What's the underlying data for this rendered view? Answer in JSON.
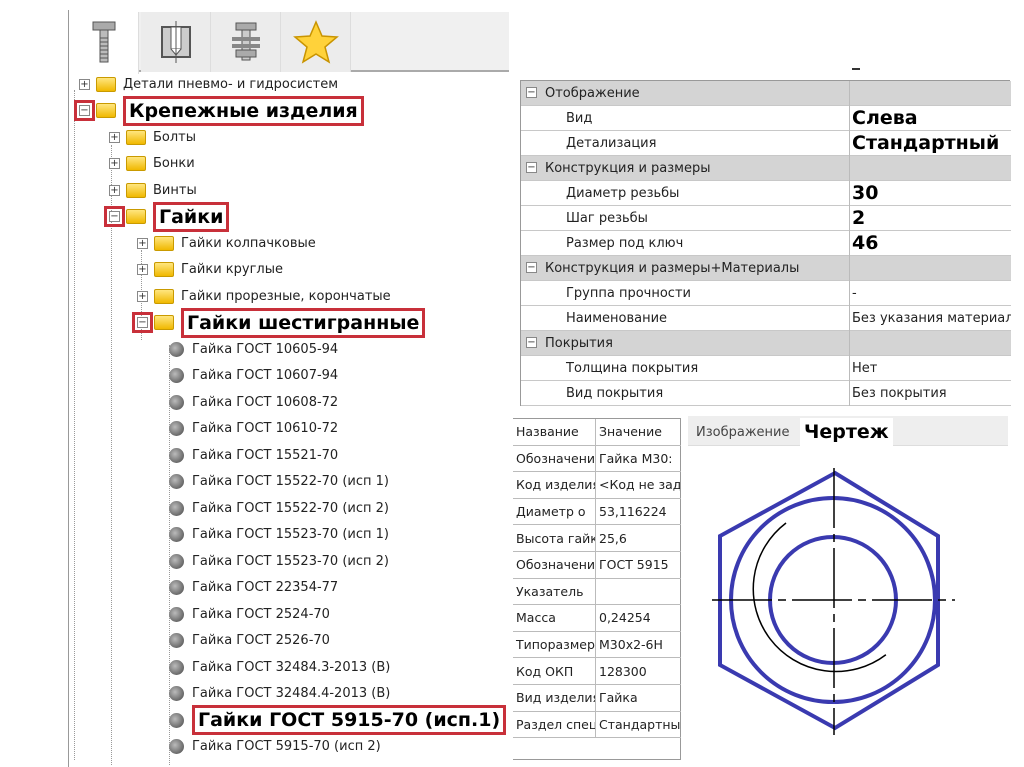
{
  "tabs": [
    {
      "icon": "bolt-icon"
    },
    {
      "icon": "hole-section-icon"
    },
    {
      "icon": "bolt-assembly-icon"
    },
    {
      "icon": "star-icon"
    }
  ],
  "tree": [
    {
      "label": "Детали пневмо- и гидросистем",
      "level": 0,
      "type": "folder",
      "exp": "+"
    },
    {
      "label": "Крепежные изделия",
      "level": 0,
      "type": "folder",
      "exp": "−",
      "hl": true
    },
    {
      "label": "Болты",
      "level": 1,
      "type": "folder",
      "exp": "+"
    },
    {
      "label": "Бонки",
      "level": 1,
      "type": "folder",
      "exp": "+"
    },
    {
      "label": "Винты",
      "level": 1,
      "type": "folder",
      "exp": "+"
    },
    {
      "label": "Гайки",
      "level": 1,
      "type": "folder",
      "exp": "−",
      "hl": true
    },
    {
      "label": "Гайки колпачковые",
      "level": 2,
      "type": "folder",
      "exp": "+"
    },
    {
      "label": "Гайки круглые",
      "level": 2,
      "type": "folder",
      "exp": "+"
    },
    {
      "label": "Гайки прорезные, корончатые",
      "level": 2,
      "type": "folder",
      "exp": "+"
    },
    {
      "label": "Гайки шестигранные",
      "level": 2,
      "type": "folder",
      "exp": "−",
      "hl": true
    },
    {
      "label": "Гайка ГОСТ 10605-94",
      "level": 3,
      "type": "item"
    },
    {
      "label": "Гайка ГОСТ 10607-94",
      "level": 3,
      "type": "item"
    },
    {
      "label": "Гайка ГОСТ 10608-72",
      "level": 3,
      "type": "item"
    },
    {
      "label": "Гайка ГОСТ 10610-72",
      "level": 3,
      "type": "item"
    },
    {
      "label": "Гайка ГОСТ 15521-70",
      "level": 3,
      "type": "item"
    },
    {
      "label": "Гайка ГОСТ 15522-70 (исп 1)",
      "level": 3,
      "type": "item"
    },
    {
      "label": "Гайка ГОСТ 15522-70 (исп 2)",
      "level": 3,
      "type": "item"
    },
    {
      "label": "Гайка ГОСТ 15523-70 (исп 1)",
      "level": 3,
      "type": "item"
    },
    {
      "label": "Гайка ГОСТ 15523-70 (исп 2)",
      "level": 3,
      "type": "item"
    },
    {
      "label": "Гайка ГОСТ 22354-77",
      "level": 3,
      "type": "item"
    },
    {
      "label": "Гайка ГОСТ 2524-70",
      "level": 3,
      "type": "item"
    },
    {
      "label": "Гайка ГОСТ 2526-70",
      "level": 3,
      "type": "item"
    },
    {
      "label": "Гайка ГОСТ 32484.3-2013 (В)",
      "level": 3,
      "type": "item"
    },
    {
      "label": "Гайка ГОСТ 32484.4-2013 (В)",
      "level": 3,
      "type": "item"
    },
    {
      "label": "Гайки ГОСТ 5915-70 (исп.1)",
      "level": 3,
      "type": "item",
      "hl": true
    },
    {
      "label": "Гайка ГОСТ 5915-70 (исп 2)",
      "level": 3,
      "type": "item"
    }
  ],
  "properties": [
    {
      "name": "Отображение",
      "header": true
    },
    {
      "name": "Вид",
      "value": "Слева",
      "bold": true
    },
    {
      "name": "Детализация",
      "value": "Стандартный",
      "bold": true
    },
    {
      "name": "Конструкция и размеры",
      "header": true
    },
    {
      "name": "Диаметр резьбы",
      "value": "30",
      "bold": true
    },
    {
      "name": "Шаг резьбы",
      "value": "2",
      "bold": true
    },
    {
      "name": "Размер под ключ",
      "value": "46",
      "bold": true
    },
    {
      "name": "Конструкция и размеры+Материалы",
      "header": true
    },
    {
      "name": "Группа прочности",
      "value": "-"
    },
    {
      "name": "Наименование",
      "value": "Без указания материала"
    },
    {
      "name": "Покрытия",
      "header": true
    },
    {
      "name": "Толщина покрытия",
      "value": "Нет"
    },
    {
      "name": "Вид покрытия",
      "value": "Без покрытия"
    }
  ],
  "attributes": {
    "headers": [
      "Название",
      "Значение"
    ],
    "rows": [
      [
        "Обозначение",
        "Гайка М30:"
      ],
      [
        "Код изделия",
        "<Код не задан>"
      ],
      [
        "Диаметр о",
        "53,116224"
      ],
      [
        "Высота гайки",
        "25,6"
      ],
      [
        "Обозначение",
        "ГОСТ 5915"
      ],
      [
        "Указатель",
        ""
      ],
      [
        "Масса",
        "0,24254"
      ],
      [
        "Типоразмер",
        "М30x2-6H"
      ],
      [
        "Код ОКП",
        "128300"
      ],
      [
        "Вид изделия",
        "Гайка"
      ],
      [
        "Раздел спецификации",
        "Стандартные"
      ]
    ]
  },
  "preview": {
    "tabs": [
      "Изображение",
      "Чертеж"
    ],
    "active": 1,
    "line_color": "#3a3ab0"
  }
}
